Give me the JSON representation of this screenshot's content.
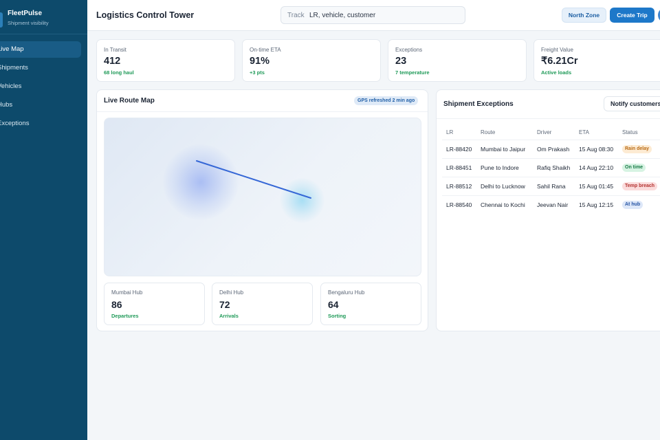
{
  "app": {
    "name": "FleetPulse",
    "subtitle": "Shipment visibility"
  },
  "sidebar": {
    "items": [
      {
        "label": "Live Map",
        "active": true
      },
      {
        "label": "Shipments",
        "active": false
      },
      {
        "label": "Vehicles",
        "active": false
      },
      {
        "label": "Hubs",
        "active": false
      },
      {
        "label": "Exceptions",
        "active": false
      }
    ]
  },
  "header": {
    "title": "Logistics Control Tower",
    "search_prefix": "Track",
    "search_placeholder": "LR, vehicle, customer",
    "zone_button": "North Zone",
    "create_button": "Create Trip"
  },
  "kpis": [
    {
      "label": "In Transit",
      "value": "412",
      "sub": "68 long haul"
    },
    {
      "label": "On-time ETA",
      "value": "91%",
      "sub": "+3 pts"
    },
    {
      "label": "Exceptions",
      "value": "23",
      "sub": "7 temperature"
    },
    {
      "label": "Freight Value",
      "value": "₹6.21Cr",
      "sub": "Active loads"
    }
  ],
  "map": {
    "title": "Live Route Map",
    "badge": "GPS refreshed 2 min ago",
    "hubs": [
      {
        "label": "Mumbai Hub",
        "value": "86",
        "sub": "Departures"
      },
      {
        "label": "Delhi Hub",
        "value": "72",
        "sub": "Arrivals"
      },
      {
        "label": "Bengaluru Hub",
        "value": "64",
        "sub": "Sorting"
      }
    ]
  },
  "exceptions": {
    "title": "Shipment Exceptions",
    "notify_button": "Notify customers",
    "columns": [
      "LR",
      "Route",
      "Driver",
      "ETA",
      "Status"
    ],
    "rows": [
      {
        "lr": "LR-88420",
        "route": "Mumbai to Jaipur",
        "driver": "Om Prakash",
        "eta": "15 Aug 08:30",
        "status": "Rain delay",
        "status_color": "#b86a14",
        "status_bg": "#fdebd3"
      },
      {
        "lr": "LR-88451",
        "route": "Pune to Indore",
        "driver": "Rafiq Shaikh",
        "eta": "14 Aug 22:10",
        "status": "On time",
        "status_color": "#177a45",
        "status_bg": "#d7f3e3"
      },
      {
        "lr": "LR-88512",
        "route": "Delhi to Lucknow",
        "driver": "Sahil Rana",
        "eta": "15 Aug 01:45",
        "status": "Temp breach",
        "status_color": "#b3312f",
        "status_bg": "#fbdcdc"
      },
      {
        "lr": "LR-88540",
        "route": "Chennai to Kochi",
        "driver": "Jeevan Nair",
        "eta": "15 Aug 12:15",
        "status": "At hub",
        "status_color": "#2452a3",
        "status_bg": "#dde7f8"
      }
    ]
  },
  "colors": {
    "sidebar": "#0d4a6b",
    "accent": "#1d78c9",
    "positive": "#1f9a58",
    "route": "#3567d6"
  }
}
